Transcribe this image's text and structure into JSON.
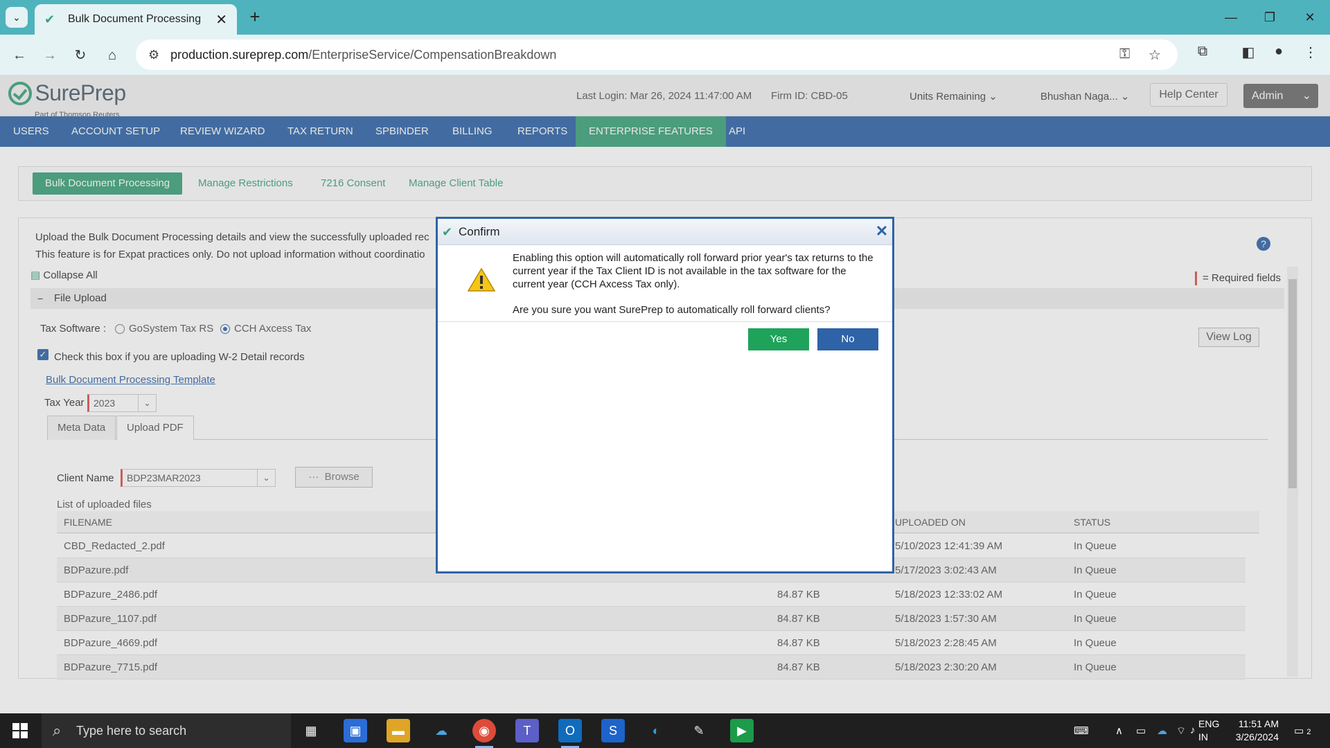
{
  "browser": {
    "tab_title": "Bulk Document Processing",
    "url_host": "production.sureprep.com",
    "url_path": "/EnterpriseService/CompensationBreakdown",
    "new_tab_symbol": "+",
    "close_symbol": "✕"
  },
  "header": {
    "brand": "SurePrep",
    "brand_sub": "Part of Thomson Reuters",
    "last_login": "Last Login:  Mar 26, 2024 11:47:00 AM",
    "firm_id": "Firm ID:  CBD-05",
    "units_remaining": "Units Remaining",
    "user_name": "Bhushan Naga...",
    "help_center": "Help Center",
    "admin": "Admin"
  },
  "nav": {
    "items": [
      "USERS",
      "ACCOUNT SETUP",
      "REVIEW WIZARD",
      "TAX RETURN",
      "SPBINDER",
      "BILLING",
      "REPORTS",
      "ENTERPRISE FEATURES",
      "API"
    ],
    "active": "ENTERPRISE FEATURES"
  },
  "subtabs": [
    "Bulk Document Processing",
    "Manage Restrictions",
    "7216 Consent",
    "Manage Client Table"
  ],
  "panel": {
    "info_line1": "Upload the Bulk Document Processing details and view the successfully uploaded rec",
    "info_line2": "This feature is for Expat practices only. Do not upload information without coordinatio",
    "collapse_all": "Collapse All",
    "required_fields": "= Required fields",
    "section_title": "File Upload",
    "tax_software_label": "Tax Software :",
    "tax_software_options": [
      "GoSystem Tax RS",
      "CCH Axcess Tax"
    ],
    "tax_software_selected": "CCH Axcess Tax",
    "w2_checkbox_label": "Check this box if you are uploading W-2 Detail records",
    "w2_checked": true,
    "template_link": "Bulk Document Processing Template",
    "tax_year_label": "Tax Year",
    "tax_year_value": "2023",
    "view_log": "View Log",
    "inner_tabs": [
      "Meta Data",
      "Upload PDF"
    ],
    "active_inner_tab": "Upload PDF",
    "client_name_label": "Client Name",
    "client_name_value": "BDP23MAR2023",
    "browse": "Browse",
    "browse_dots": "···",
    "list_label": "List of uploaded files",
    "columns": [
      "FILENAME",
      "UPLOADED ON",
      "STATUS"
    ],
    "files": [
      {
        "name": "CBD_Redacted_2.pdf",
        "size": "",
        "uploaded": "5/10/2023 12:41:39 AM",
        "status": "In Queue"
      },
      {
        "name": "BDPazure.pdf",
        "size": "",
        "uploaded": "5/17/2023 3:02:43 AM",
        "status": "In Queue"
      },
      {
        "name": "BDPazure_2486.pdf",
        "size": "84.87 KB",
        "uploaded": "5/18/2023 12:33:02 AM",
        "status": "In Queue"
      },
      {
        "name": "BDPazure_1107.pdf",
        "size": "84.87 KB",
        "uploaded": "5/18/2023 1:57:30 AM",
        "status": "In Queue"
      },
      {
        "name": "BDPazure_4669.pdf",
        "size": "84.87 KB",
        "uploaded": "5/18/2023 2:28:45 AM",
        "status": "In Queue"
      },
      {
        "name": "BDPazure_7715.pdf",
        "size": "84.87 KB",
        "uploaded": "5/18/2023 2:30:20 AM",
        "status": "In Queue"
      }
    ]
  },
  "dialog": {
    "title": "Confirm",
    "message": "Enabling this option will automatically roll forward prior year's tax returns to the current year if the Tax Client ID is not available in the tax software for the current year (CCH Axcess Tax only).",
    "question": "Are you sure you want SurePrep to automatically roll forward clients?",
    "yes": "Yes",
    "no": "No"
  },
  "taskbar": {
    "search_placeholder": "Type here to search",
    "lang1": "ENG",
    "lang2": "IN",
    "time": "11:51 AM",
    "date": "3/26/2024",
    "notification_count": "2"
  },
  "colors": {
    "brand_green": "#3aa17a",
    "nav_blue": "#2e63a7",
    "chrome_teal": "#4fb3bd",
    "yes_green": "#1fa35b"
  }
}
